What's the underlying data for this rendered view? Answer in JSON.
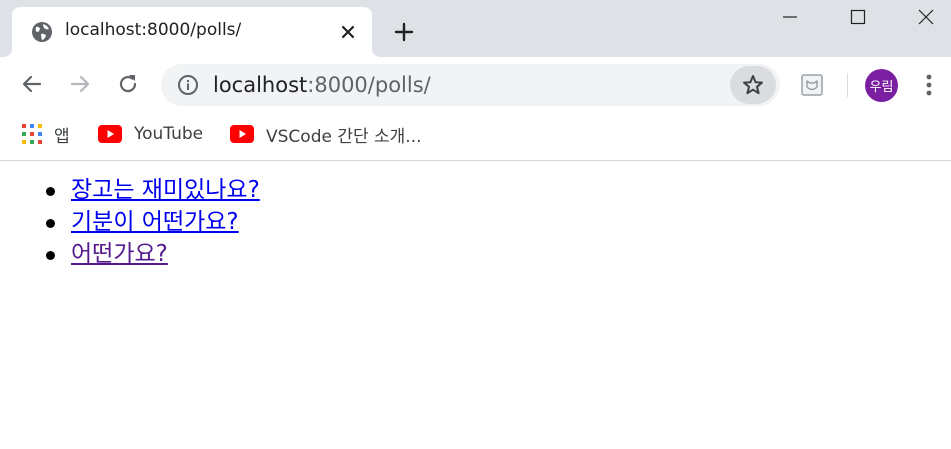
{
  "browser": {
    "tab": {
      "title": "localhost:8000/polls/",
      "favicon": "globe-icon"
    },
    "window_controls": [
      "minimize-icon",
      "maximize-icon",
      "close-icon"
    ],
    "address": {
      "host": "localhost",
      "rest": ":8000/polls/"
    },
    "profile": {
      "initials": "우림",
      "color": "#7b1fa2"
    },
    "bookmarks": [
      {
        "label": "앱",
        "icon": "apps-icon"
      },
      {
        "label": "YouTube",
        "icon": "youtube-icon"
      },
      {
        "label": "VSCode 간단 소개...",
        "icon": "youtube-icon"
      }
    ]
  },
  "page": {
    "questions": [
      {
        "text": "장고는 재미있나요?",
        "visited": false
      },
      {
        "text": "기분이 어떤가요?",
        "visited": false
      },
      {
        "text": "어떤가요?",
        "visited": true
      }
    ]
  },
  "colors": {
    "link": "#0000ee",
    "visited_link": "#551a8b",
    "youtube_red": "#ff0000",
    "tabstrip": "#dee1e6"
  }
}
